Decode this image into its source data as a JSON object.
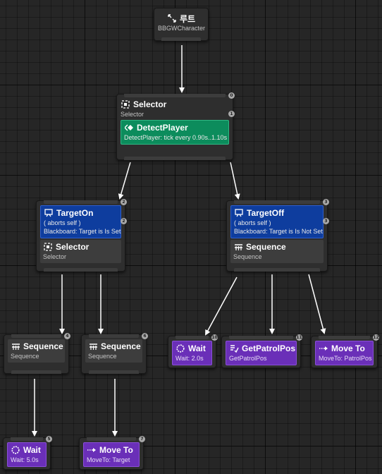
{
  "nodes": {
    "root": {
      "title": "루트",
      "subtitle": "BBGWCharacter"
    },
    "selector_main": {
      "title": "Selector",
      "subtitle": "Selector",
      "badge": "0"
    },
    "detect_player": {
      "title": "DetectPlayer",
      "subtitle": "DetectPlayer: tick every 0.90s..1.10s",
      "badge": "1"
    },
    "target_on": {
      "title": "TargetOn",
      "aborts": "( aborts self )",
      "condition": "Blackboard: Target is Is Set",
      "badge": "2"
    },
    "selector_left": {
      "title": "Selector",
      "subtitle": "Selector",
      "badge": "2"
    },
    "target_off": {
      "title": "TargetOff",
      "aborts": "( aborts self )",
      "condition": "Blackboard: Target is Is Not Set",
      "badge": "3"
    },
    "sequence_right": {
      "title": "Sequence",
      "subtitle": "Sequence",
      "badge": "3"
    },
    "sequence_a": {
      "title": "Sequence",
      "subtitle": "Sequence",
      "badge": "4"
    },
    "sequence_b": {
      "title": "Sequence",
      "subtitle": "Sequence",
      "badge": "6"
    },
    "wait_right": {
      "title": "Wait",
      "subtitle": "Wait: 2.0s",
      "badge": "10"
    },
    "get_patrol": {
      "title": "GetPatrolPos",
      "subtitle": "GetPatrolPos",
      "badge": "11"
    },
    "move_patrol": {
      "title": "Move To",
      "subtitle": "MoveTo: PatrolPos",
      "badge": "12"
    },
    "wait_left": {
      "title": "Wait",
      "subtitle": "Wait: 5.0s",
      "badge": "5"
    },
    "move_target": {
      "title": "Move To",
      "subtitle": "MoveTo: Target",
      "badge": "7"
    }
  },
  "colors": {
    "canvas": "#262626",
    "task": "#6a2fb8",
    "service": "#0c8c5c",
    "decorator": "#0e3d9e",
    "wire": "#ffffff"
  },
  "icons": {
    "root": "root-icon",
    "selector": "selector-icon",
    "sequence": "sequence-icon",
    "service": "service-icon",
    "decorator": "blackboard-icon",
    "wait": "wait-icon",
    "move": "move-to-icon",
    "task": "task-icon"
  }
}
